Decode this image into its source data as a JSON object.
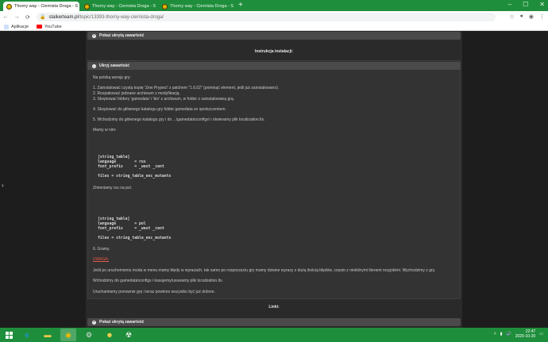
{
  "browser": {
    "tabs": [
      {
        "label": "Thorny way - Ciernista Droga - S",
        "active": true
      },
      {
        "label": "Thorny way - Ciernista Droga - S",
        "active": false
      },
      {
        "label": "Thorny way - Ciernista Droga - S",
        "active": false
      }
    ],
    "new_tab": "+",
    "url_host": "stalkerteam.pl",
    "url_path": "/topic/13393-thorny-way-ciernista-droga/",
    "bookmarks": [
      "Aplikacje",
      "YouTube"
    ]
  },
  "page": {
    "spoiler_label_top": "Pokaż ukrytą zawartość",
    "install_title": "Instrukcja instalacji:",
    "spoiler_label_open": "Ukryj zawartość",
    "intro": "Na polską wersję gry:",
    "steps": [
      "1. Zainstalować czystą kopię 'Zew Prypeci' z patchem \"1.6.02\" (pominąć element, jeśli już zainstalowano).",
      "2. Rozpakować pobrane archiwum z modyfikacją.",
      "3. Skopiować foldery 'gamedata' i 'bin' z archiwum, w folder z zainstalowaną grą."
    ],
    "step4": "4. Skopiować do głównego katalogu gry folder gamedata ze spolszczeniem.",
    "step5": "5. Wchodzimy do głównego katalogu gry i do ...\\gamedata\\configs\\ i otwieramy plik localization.ltx.",
    "have_it": "Mamy w nim:",
    "code1": [
      "[string_table]",
      "language        = rus",
      "font_prefix     = _west _cent",
      "",
      "files = string_table_enc_mutants"
    ],
    "change": "Zmieniamy rus na pol.",
    "code2": [
      "[string_table]",
      "language        = pol",
      "font_prefix     = _west _cent",
      "",
      "files = string_table_enc_mutants"
    ],
    "step6": "6. Gramy.",
    "warning_label": "UWAGA:",
    "warning_text": "Jeśli po uruchomieniu moda w menu mamy błędy w wyrazach, tak samo po rozpoczęciu gry mamy dziwne wyrazy z dużą ilością błędów, często z niektórymi literami rosyjskimi. Wychodzimy z gry.",
    "fix1": "Wchodzimy do gamedata\\configs i kasujemy/usuwamy plik localization.ltx.",
    "fix2": "Uruchamiamy ponownie grę i teraz powinno wszystko być już dobrze.",
    "links_title": "Linki:",
    "spoiler_label_bottom": "Pokaż ukrytą zawartość"
  },
  "taskbar": {
    "time": "22:47",
    "date": "2020-10-20"
  }
}
